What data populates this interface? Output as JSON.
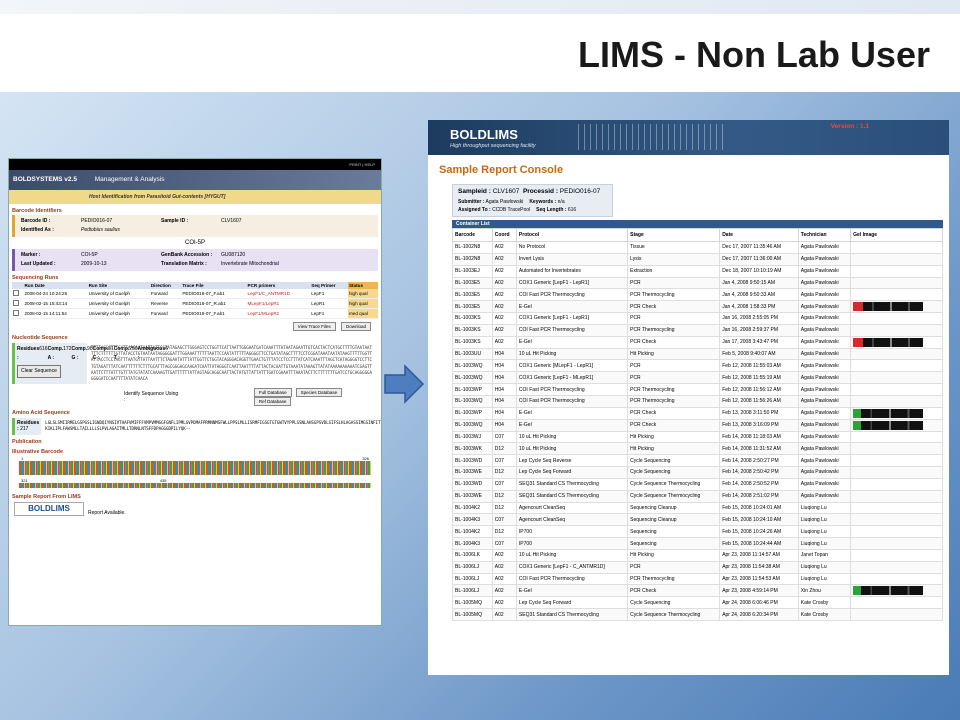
{
  "slide_title": "LIMS - Non Lab User",
  "bold": {
    "header_links": "PRINT   |   HELP",
    "brand": "BOLDSYSTEMS v2.5",
    "section": "Management & Analysis",
    "page_title": "Host Identification from Parasitoid Gut-contents [HYGUT]",
    "barcode_identifiers_title": "Barcode Identifiers",
    "ids": {
      "barcode_label": "Barcode ID :",
      "barcode": "PEDIO016-07",
      "sample_label": "Sample ID :",
      "sample": "CLV1607",
      "identified_label": "Identified As :",
      "identified": "Pediobius saulius"
    },
    "marker_heading": "COI-5P",
    "marker": {
      "marker_label": "Marker :",
      "marker": "COI-5P",
      "genbank_label": "GenBank Accession :",
      "genbank": "GU087120",
      "updated_label": "Last Updated :",
      "updated": "2009-10-13",
      "matrix_label": "Translation Matrix :",
      "matrix": "Invertebrate Mitochondrial"
    },
    "runs_title": "Sequencing Runs",
    "run_cols": [
      "",
      "Run Date",
      "Run Site",
      "Direction",
      "Trace File",
      "PCR primers",
      "Seq Primer",
      "Status"
    ],
    "runs": [
      [
        "2008-04-24 10:24:26",
        "University of Guelph",
        "Forward",
        "PEDIO016-07_F.ab1",
        "LepF1/C_ANTMR1D",
        "LepF1",
        "high qual"
      ],
      [
        "2008-02-15 15:43:14",
        "University of Guelph",
        "Reverse",
        "PEDIO016-07_R.ab1",
        "MLepF1/LepR1",
        "LepR1",
        "high qual"
      ],
      [
        "2008-02-15 14:11:54",
        "University of Guelph",
        "Forward",
        "PEDIO016-07_F.ab1",
        "LepF1/MLepR1",
        "LepF1",
        "med qual"
      ]
    ],
    "view_trace": "View Trace Files",
    "download": "Download",
    "nucleotide_title": "Nucleotide Sequence",
    "stats": [
      [
        "Residues :",
        "616"
      ],
      [
        "Comp. A :",
        "172"
      ],
      [
        "Comp. G :",
        "98"
      ],
      [
        "Comp. C :",
        "81"
      ],
      [
        "Comp. T :",
        "259"
      ],
      [
        "Ambiguous :",
        "6"
      ]
    ],
    "sequence": "TTTTAGGCTTTCATTAAGAATAATTATTCGTATAGAGCTTGGGAGTCCTGGTTCATTAATTGGGAATGATCAAATTTATAATAGAATTGTCACTACTCATGCTTTTGTAATAATTTTCTTTTTTGTTATACCTGTAATAATAGGGGGATTTGGAAATTTTTTAATTCCAATATTTTTAGGGGTTCCTGATATAGCTTTTCCTCGGATAAATAATATAAGTTTTTGGTTATTACCTCCTAGTTTAATGTTATTAATTTCTAGAATATTTATTGGTTCTGGTACAGGGACAGGTTGAACTGTTTATCCTCCTTTATCATCAAATTTAGCTCATAGGGGTCCTTCTGTAGATTTATCAATTTTTTCTTTGCATTTAGCGGGAGCAAGATCAATTATAGGGTCAATTAATTTTATTACTACAATTGTAAATATAAAGTTATATAAAAAAAAAATCGAGTTAATTCTTTATTTGTTTATGTATATCAAAAGTTGATTTTTTATTAGTAGCAGGCAATTACTATGTTATTATTTGATCGAAATTTAAATACTTCTTTTTTTGATCCTGCAGGGGGAGGGGATCCAATTTTATATCAACA",
    "clear_sequence": "Clear Sequence",
    "identify_label": "Identify Sequence Using :",
    "identify_buttons": [
      "Full Database",
      "Species Database",
      "Ref Database"
    ],
    "aa_title": "Amino Acid Sequence",
    "aa_residues_label": "Residues :",
    "aa_residues": "217",
    "aa_sequence": "LGLSLSMIIRMELGSPGSLIGNDQIYNSIVTHAFVMIFFFVMPVMMGGFGNFLIPMLGVPDMAFPRMNNMSFWLLPPSLMLLISRMFIGSGTGTGWTVYPPLSSNLAHSGPSVDLSIFSLHLAGASSIMGSINFITTIVNMKLYK-KIKLIPLFAWSMLLTAILLLLSLPVLAGAITMLLTDRNLNTSFFDPAGGGDPILYQK--",
    "publication_title": "Publication",
    "illustrative_title": "Illustrative Barcode",
    "barcode_scale": [
      "1",
      "326",
      "321",
      "435"
    ],
    "report_title": "Sample Report From LIMS",
    "report_logo": "BOLDLIMS",
    "report_text": "Report Available."
  },
  "lims": {
    "logo": "BOLDLIMS",
    "tagline": "High throughput sequencing facility",
    "version": "Version : 1.1",
    "console_title": "Sample Report Console",
    "sampleid_label": "Sampleid :",
    "sampleid": "CLV1607",
    "processid_label": "Processid :",
    "processid": "PEDIO016-07",
    "submitter_label": "Submitter :",
    "submitter": "Agata Pawlowski",
    "keywords_label": "Keywords :",
    "keywords": "n/a",
    "assigned_label": "Assigned To :",
    "assigned": "CCDB TracePool",
    "seqlength_label": "Seq Length :",
    "seqlength": "616",
    "container_list": "Container List",
    "columns": [
      "Barcode",
      "Coord",
      "Protocol",
      "Stage",
      "Date",
      "Technician",
      "Gel Image"
    ],
    "rows": [
      [
        "BL-1002N8",
        "A02",
        "No Protocol",
        "Tissue",
        "Dec 17, 2007 11:35:46 AM",
        "Agata Pawlowski",
        ""
      ],
      [
        "BL-1002N8",
        "A02",
        "Invert Lysis",
        "Lysis",
        "Dec 17, 2007 11:36:00 AM",
        "Agata Pawlowski",
        ""
      ],
      [
        "BL-1003EJ",
        "A02",
        "Automated for Invertebrates",
        "Extraction",
        "Dec 18, 2007 10:10:19 AM",
        "Agata Pawlowski",
        ""
      ],
      [
        "BL-1003E5",
        "A02",
        "COX1 Generic [LepF1 - LepR1]",
        "PCR",
        "Jan 4, 2008 9:50:15 AM",
        "Agata Pawlowski",
        ""
      ],
      [
        "BL-1003E5",
        "A02",
        "COI Fast PCR Thermocycling",
        "PCR Thermocycling",
        "Jan 4, 2008 9:50:33 AM",
        "Agata Pawlowski",
        ""
      ],
      [
        "BL-1003E5",
        "A02",
        "E-Gel",
        "PCR Check",
        "Jan 4, 2008 1:58:33 PM",
        "Agata Pawlowski",
        "red"
      ],
      [
        "BL-1003KS",
        "A02",
        "COX1 Generic [LepF1 - LepR1]",
        "PCR",
        "Jan 16, 2008 2:55:05 PM",
        "Agata Pawlowski",
        ""
      ],
      [
        "BL-1003KS",
        "A02",
        "COI Fast PCR Thermocycling",
        "PCR Thermocycling",
        "Jan 16, 2008 2:59:37 PM",
        "Agata Pawlowski",
        ""
      ],
      [
        "BL-1003KS",
        "A02",
        "E-Gel",
        "PCR Check",
        "Jan 17, 2008 3:43:47 PM",
        "Agata Pawlowski",
        "red"
      ],
      [
        "BL-1003UU",
        "H04",
        "10 uL Hit Picking",
        "Hit Picking",
        "Feb 5, 2008 9:40:07 AM",
        "Agata Pawlowski",
        ""
      ],
      [
        "BL-1003WQ",
        "H04",
        "COX1 Generic [MLepF1 - LepR1]",
        "PCR",
        "Feb 12, 2008 11:55:03 AM",
        "Agata Pawlowski",
        ""
      ],
      [
        "BL-1003WQ",
        "H04",
        "COX1 Generic [LepF1 - MLepR1]",
        "PCR",
        "Feb 12, 2008 11:55:19 AM",
        "Agata Pawlowski",
        ""
      ],
      [
        "BL-1003WP",
        "H04",
        "COI Fast PCR Thermocycling",
        "PCR Thermocycling",
        "Feb 12, 2008 11:56:12 AM",
        "Agata Pawlowski",
        ""
      ],
      [
        "BL-1003WQ",
        "H04",
        "COI Fast PCR Thermocycling",
        "PCR Thermocycling",
        "Feb 12, 2008 11:56:26 AM",
        "Agata Pawlowski",
        ""
      ],
      [
        "BL-1003WP",
        "H04",
        "E-Gel",
        "PCR Check",
        "Feb 13, 2008 3:11:50 PM",
        "Agata Pawlowski",
        "green"
      ],
      [
        "BL-1003WQ",
        "H04",
        "E-Gel",
        "PCR Check",
        "Feb 13, 2008 3:16:09 PM",
        "Agata Pawlowski",
        "green"
      ],
      [
        "BL-1003WJ",
        "C07",
        "10 uL Hit Picking",
        "Hit Picking",
        "Feb 14, 2008 11:18:03 AM",
        "Agata Pawlowski",
        ""
      ],
      [
        "BL-1003WK",
        "D12",
        "10 uL Hit Picking",
        "Hit Picking",
        "Feb 14, 2008 11:31:52 AM",
        "Agata Pawlowski",
        ""
      ],
      [
        "BL-1003WD",
        "C07",
        "Lep Cycle Seq Reverse",
        "Cycle Sequencing",
        "Feb 14, 2008 2:50:27 PM",
        "Agata Pawlowski",
        ""
      ],
      [
        "BL-1003WE",
        "D12",
        "Lep Cycle Seq Forward",
        "Cycle Sequencing",
        "Feb 14, 2008 2:50:42 PM",
        "Agata Pawlowski",
        ""
      ],
      [
        "BL-1003WD",
        "C07",
        "SEQ31 Standard CS Thermocycling",
        "Cycle Sequence Thermocycling",
        "Feb 14, 2008 2:50:52 PM",
        "Agata Pawlowski",
        ""
      ],
      [
        "BL-1003WE",
        "D12",
        "SEQ31 Standard CS Thermocycling",
        "Cycle Sequence Thermocycling",
        "Feb 14, 2008 2:51:02 PM",
        "Agata Pawlowski",
        ""
      ],
      [
        "BL-1004K2",
        "D12",
        "Agencourt CleanSeq",
        "Sequencing Cleanup",
        "Feb 15, 2008 10:24:01 AM",
        "Liuqiong Lu",
        ""
      ],
      [
        "BL-1004K3",
        "C07",
        "Agencourt CleanSeq",
        "Sequencing Cleanup",
        "Feb 15, 2008 10:24:10 AM",
        "Liuqiong Lu",
        ""
      ],
      [
        "BL-1004K2",
        "D12",
        "IP700",
        "Sequencing",
        "Feb 15, 2008 10:24:26 AM",
        "Liuqiong Lu",
        ""
      ],
      [
        "BL-1004K3",
        "C07",
        "IP700",
        "Sequencing",
        "Feb 15, 2008 10:24:44 AM",
        "Liuqiong Lu",
        ""
      ],
      [
        "BL-1006LK",
        "A02",
        "10 uL Hit Picking",
        "Hit Picking",
        "Apr 23, 2008 11:14:57 AM",
        "Janet Topan",
        ""
      ],
      [
        "BL-1006LJ",
        "A02",
        "COX1 Generic [LepF1 - C_ANTMR1D]",
        "PCR",
        "Apr 23, 2008 11:54:38 AM",
        "Liuqiong Lu",
        ""
      ],
      [
        "BL-1006LJ",
        "A02",
        "COI Fast PCR Thermocycling",
        "PCR Thermocycling",
        "Apr 23, 2008 11:54:53 AM",
        "Liuqiong Lu",
        ""
      ],
      [
        "BL-1006LJ",
        "A02",
        "E-Gel",
        "PCR Check",
        "Apr 23, 2008 4:59:14 PM",
        "Xin Zhou",
        "green"
      ],
      [
        "BL-1005MQ",
        "A02",
        "Lep Cycle Seq Forward",
        "Cycle Sequencing",
        "Apr 24, 2008 6:06:46 PM",
        "Kate Crosby",
        ""
      ],
      [
        "BL-1005MQ",
        "A02",
        "SEQ31 Standard CS Thermocycling",
        "Cycle Sequence Thermocycling",
        "Apr 24, 2008 6:20:34 PM",
        "Kate Crosby",
        ""
      ]
    ]
  }
}
